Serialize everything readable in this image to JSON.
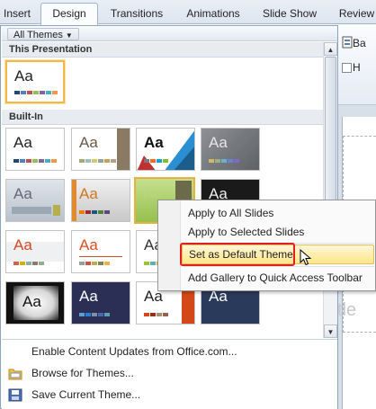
{
  "ribbon": {
    "tabs": [
      {
        "label": "Insert"
      },
      {
        "label": "Design"
      },
      {
        "label": "Transitions"
      },
      {
        "label": "Animations"
      },
      {
        "label": "Slide Show"
      },
      {
        "label": "Review"
      }
    ],
    "right_button_1": "Ba",
    "right_button_2": "H"
  },
  "slide": {
    "ghost_text": "tle"
  },
  "gallery": {
    "filter_label": "All Themes",
    "sections": {
      "this_presentation": "This Presentation",
      "built_in": "Built-In"
    },
    "thumb_text": "Aa",
    "footer": [
      {
        "label": "Enable Content Updates from Office.com..."
      },
      {
        "label": "Browse for Themes..."
      },
      {
        "label": "Save Current Theme..."
      }
    ]
  },
  "context_menu": {
    "items": [
      {
        "label": "Apply to All Slides"
      },
      {
        "label": "Apply to Selected Slides"
      },
      {
        "label": "Set as Default Theme"
      },
      {
        "label": "Add Gallery to Quick Access Toolbar"
      }
    ]
  },
  "icons": {
    "dropdown": "chevron-down-icon",
    "scroll_up": "scroll-up-icon",
    "scroll_down": "scroll-down-icon",
    "browse": "folder-icon",
    "save": "save-icon",
    "cursor": "mouse-pointer-icon"
  },
  "colors": {
    "accent_highlight": "#e02020",
    "hover_gold": "#ffe58a",
    "selected_border": "#f2b84b"
  }
}
